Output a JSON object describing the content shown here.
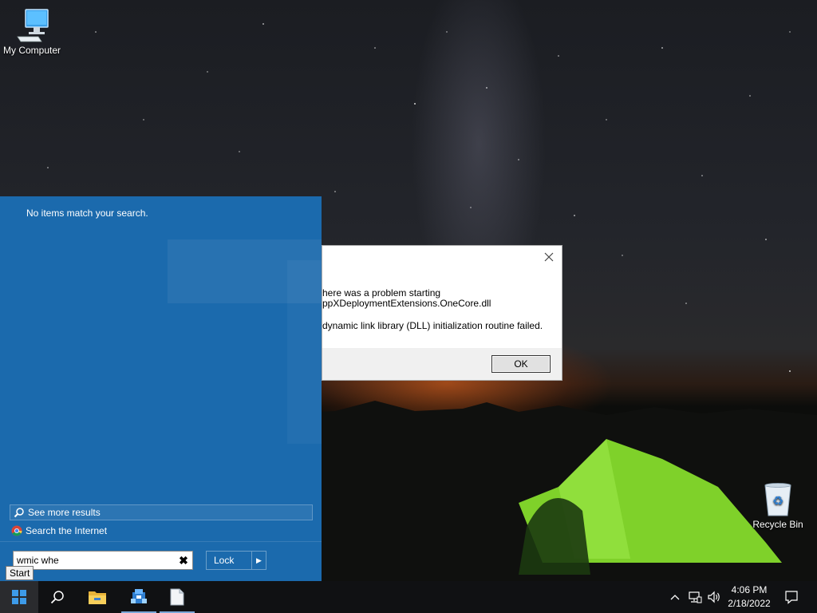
{
  "desktop": {
    "icons": [
      {
        "label": "My Computer",
        "icon": "computer-icon"
      },
      {
        "label": "Recycle Bin",
        "icon": "recycle-bin-icon"
      }
    ]
  },
  "start_panel": {
    "no_results_text": "No items match your search.",
    "see_more_label": "See more results",
    "search_internet_label": "Search the Internet",
    "search_value": "wmic whe",
    "lock_label": "Lock",
    "tooltip": "Start"
  },
  "dialog": {
    "line1": "here was a problem starting",
    "line2": "ppXDeploymentExtensions.OneCore.dll",
    "line3": " dynamic link library (DLL) initialization routine failed.",
    "ok_label": "OK"
  },
  "taskbar": {
    "pinned": [
      "search-icon",
      "file-explorer-icon",
      "network-app-icon",
      "document-icon"
    ],
    "time": "4:06 PM",
    "date": "2/18/2022"
  },
  "colors": {
    "start_panel_bg": "#1b6aad",
    "taskbar_bg": "#101113",
    "tent": "#7fd12a"
  }
}
